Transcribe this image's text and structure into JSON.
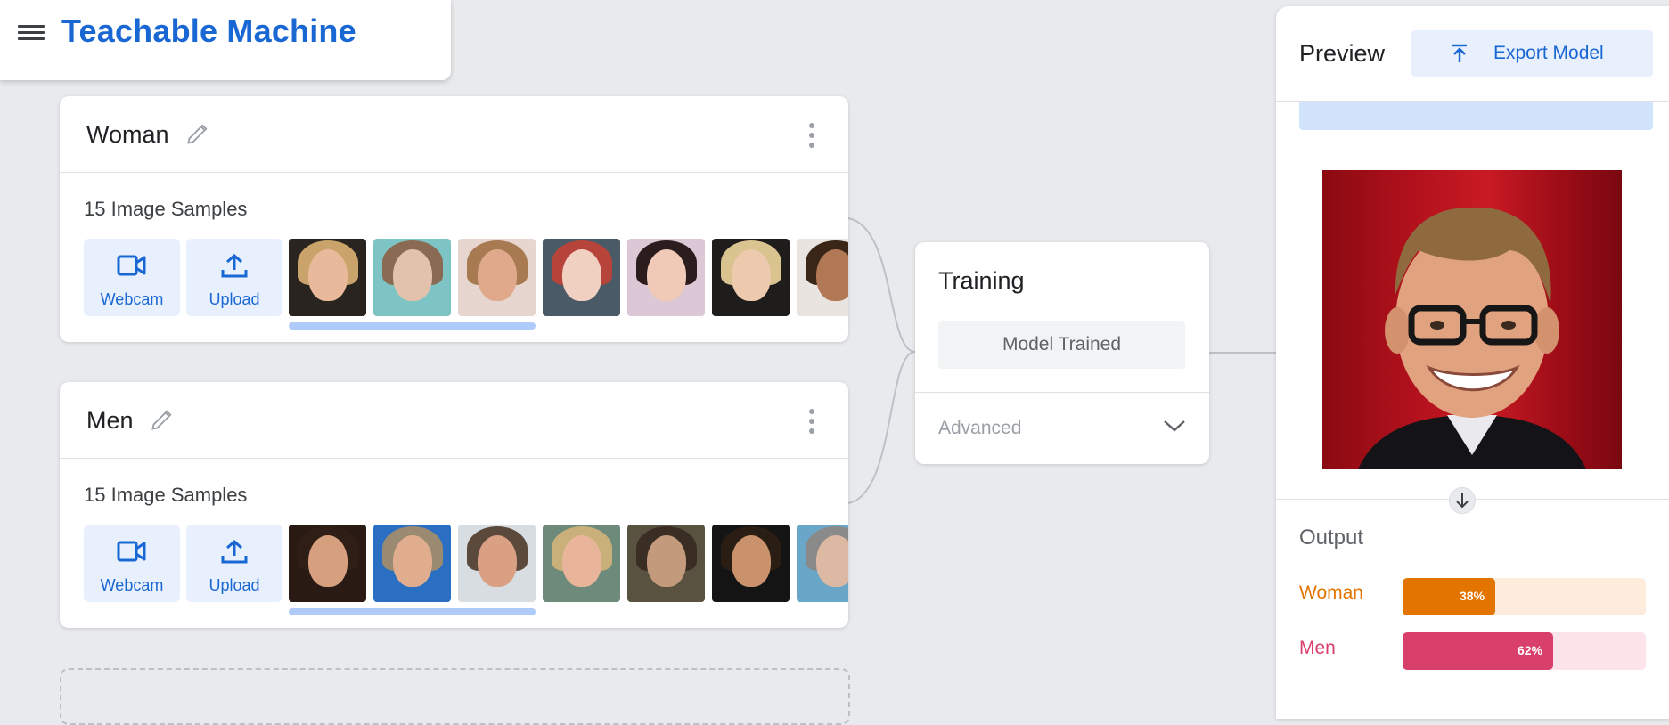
{
  "header": {
    "title": "Teachable Machine"
  },
  "classes": [
    {
      "name": "Woman",
      "samples_text": "15 Image Samples",
      "webcam_label": "Webcam",
      "upload_label": "Upload"
    },
    {
      "name": "Men",
      "samples_text": "15 Image Samples",
      "webcam_label": "Webcam",
      "upload_label": "Upload"
    }
  ],
  "training": {
    "title": "Training",
    "button_label": "Model Trained",
    "advanced_label": "Advanced"
  },
  "preview": {
    "title": "Preview",
    "export_label": "Export Model",
    "output_title": "Output",
    "outputs": [
      {
        "label": "Woman",
        "percent_text": "38%",
        "value": 0.38,
        "color": "#e37400",
        "track_color": "#fdebdc"
      },
      {
        "label": "Men",
        "percent_text": "62%",
        "value": 0.62,
        "color": "#d93f6b",
        "track_color": "#fce4ea"
      }
    ]
  },
  "colors": {
    "accent": "#1967d2",
    "accent_light": "#e8f0fe"
  }
}
